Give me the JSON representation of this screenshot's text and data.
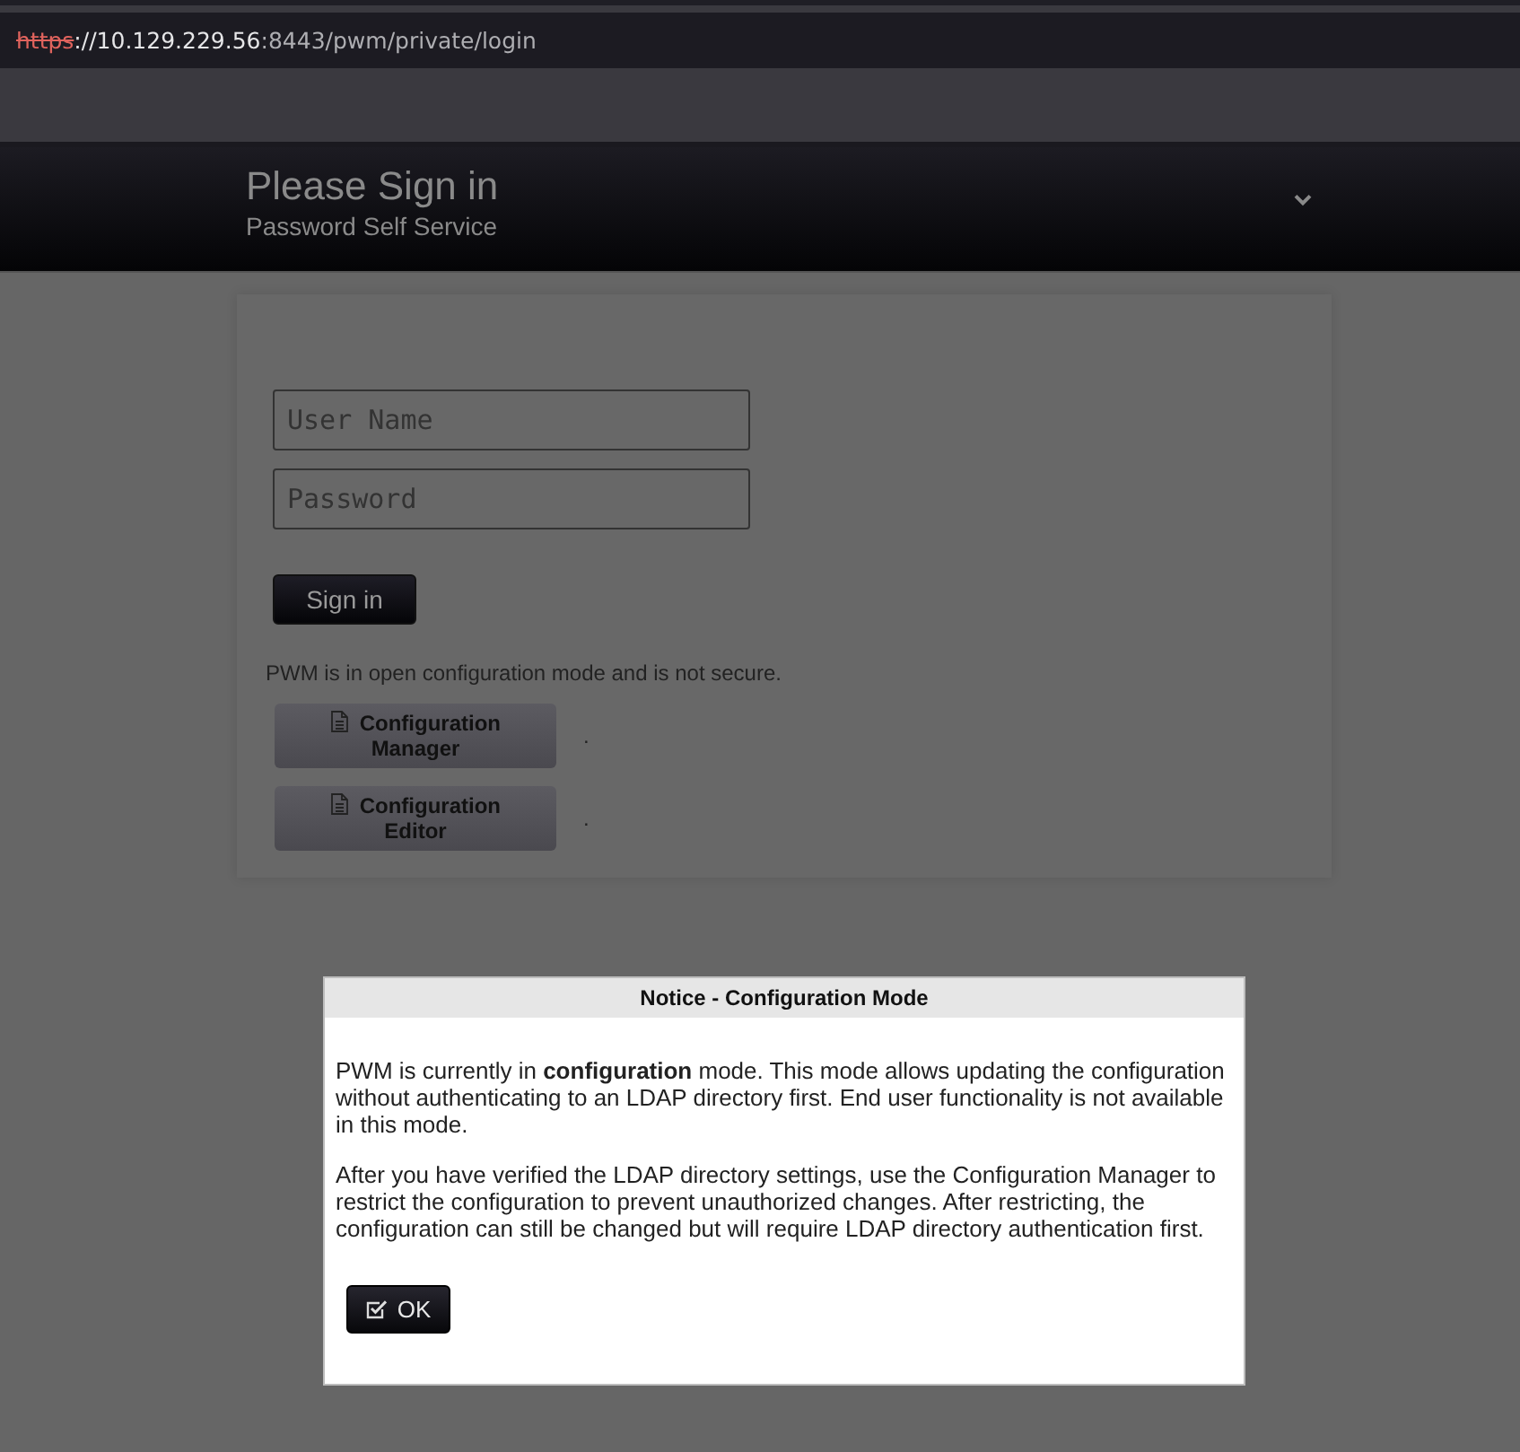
{
  "address_bar": {
    "scheme": "https",
    "scheme_insecure": true,
    "host": "://10.129.229.56",
    "path": ":8443/pwm/private/login"
  },
  "header": {
    "title": "Please Sign in",
    "subtitle": "Password Self Service"
  },
  "login_form": {
    "username": {
      "placeholder": "User Name"
    },
    "password": {
      "placeholder": "Password"
    },
    "submit": "Sign in"
  },
  "config_notice": "PWM is in open configuration mode and is not secure.",
  "config_actions": [
    {
      "label": "Configuration Manager",
      "note": "."
    },
    {
      "label": "Configuration Editor",
      "note": "."
    }
  ],
  "dialog": {
    "title": "Notice - Configuration Mode",
    "paragraphs": [
      "PWM is currently in **configuration** mode. This mode allows updating the configuration without authenticating to an LDAP directory first. End user functionality is not available in this mode.",
      "After you have verified the LDAP directory settings, use the Configuration Manager to restrict the configuration to prevent unauthorized changes. After restricting, the configuration can still be changed but will require LDAP directory authentication first."
    ],
    "button": "OK"
  }
}
